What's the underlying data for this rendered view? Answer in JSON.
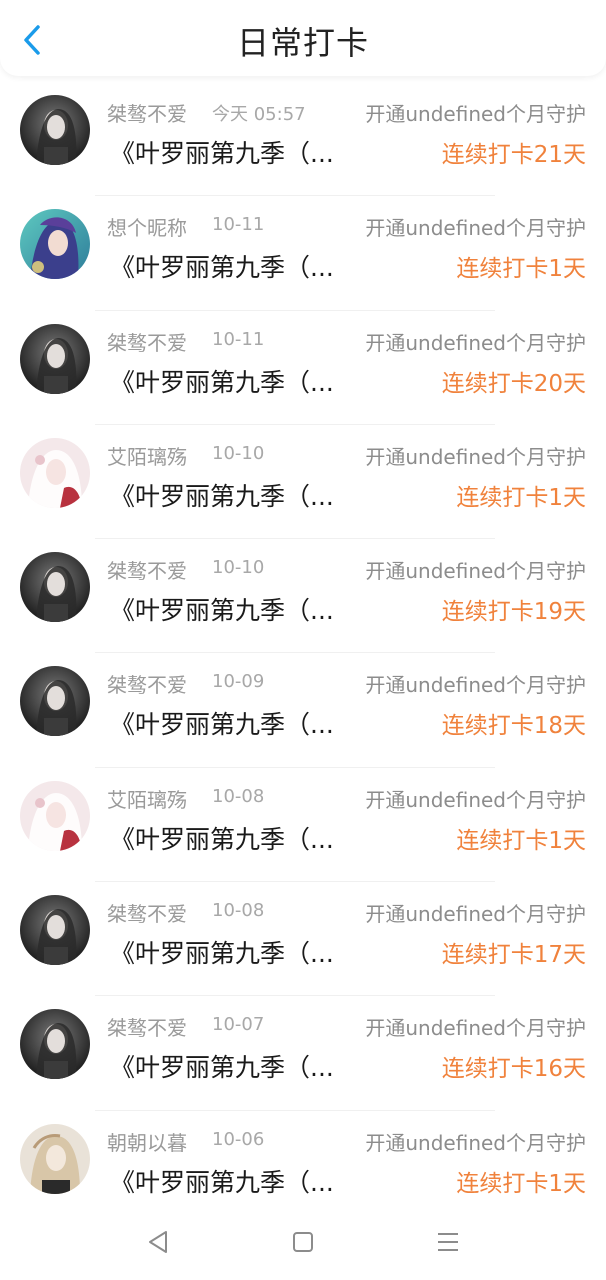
{
  "header": {
    "title": "日常打卡",
    "back_icon": "chevron-left-icon",
    "accent_color": "#1a9bea"
  },
  "list": {
    "items": [
      {
        "username": "桀骜不爱",
        "date": "今天 05:57",
        "guard": "开通undefined个月守护",
        "book": "《叶罗丽第九季（...",
        "streak": "连续打卡21天",
        "avatar": "dark"
      },
      {
        "username": "想个昵称",
        "date": "10-11",
        "guard": "开通undefined个月守护",
        "book": "《叶罗丽第九季（...",
        "streak": "连续打卡1天",
        "avatar": "teal"
      },
      {
        "username": "桀骜不爱",
        "date": "10-11",
        "guard": "开通undefined个月守护",
        "book": "《叶罗丽第九季（...",
        "streak": "连续打卡20天",
        "avatar": "dark"
      },
      {
        "username": "艾陌璃殇",
        "date": "10-10",
        "guard": "开通undefined个月守护",
        "book": "《叶罗丽第九季（...",
        "streak": "连续打卡1天",
        "avatar": "pink"
      },
      {
        "username": "桀骜不爱",
        "date": "10-10",
        "guard": "开通undefined个月守护",
        "book": "《叶罗丽第九季（...",
        "streak": "连续打卡19天",
        "avatar": "dark"
      },
      {
        "username": "桀骜不爱",
        "date": "10-09",
        "guard": "开通undefined个月守护",
        "book": "《叶罗丽第九季（...",
        "streak": "连续打卡18天",
        "avatar": "dark"
      },
      {
        "username": "艾陌璃殇",
        "date": "10-08",
        "guard": "开通undefined个月守护",
        "book": "《叶罗丽第九季（...",
        "streak": "连续打卡1天",
        "avatar": "pink"
      },
      {
        "username": "桀骜不爱",
        "date": "10-08",
        "guard": "开通undefined个月守护",
        "book": "《叶罗丽第九季（...",
        "streak": "连续打卡17天",
        "avatar": "dark"
      },
      {
        "username": "桀骜不爱",
        "date": "10-07",
        "guard": "开通undefined个月守护",
        "book": "《叶罗丽第九季（...",
        "streak": "连续打卡16天",
        "avatar": "dark"
      },
      {
        "username": "朝朝以暮",
        "date": "10-06",
        "guard": "开通undefined个月守护",
        "book": "《叶罗丽第九季（...",
        "streak": "连续打卡1天",
        "avatar": "light"
      }
    ]
  },
  "colors": {
    "streak": "#f0823c",
    "meta": "#9a9a9a",
    "text": "#1a1a1a"
  },
  "navbar": {
    "back_icon": "triangle-back-icon",
    "home_icon": "square-home-icon",
    "menu_icon": "hamburger-menu-icon"
  }
}
